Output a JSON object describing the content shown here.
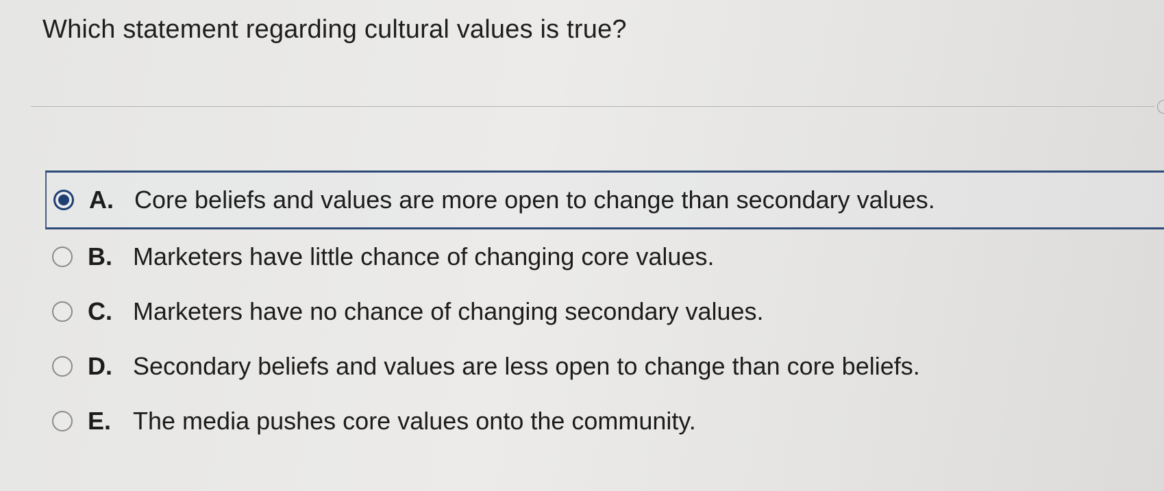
{
  "question": {
    "text": "Which statement regarding cultural values is true?"
  },
  "options": [
    {
      "letter": "A.",
      "text": "Core beliefs and values are more open to change than secondary values.",
      "selected": true
    },
    {
      "letter": "B.",
      "text": "Marketers have little chance of changing core values.",
      "selected": false
    },
    {
      "letter": "C.",
      "text": "Marketers have no chance of changing secondary values.",
      "selected": false
    },
    {
      "letter": "D.",
      "text": "Secondary beliefs and values are less open to change than core beliefs.",
      "selected": false
    },
    {
      "letter": "E.",
      "text": "The media pushes core values onto the community.",
      "selected": false
    }
  ],
  "colors": {
    "selection_accent": "#1f3f73",
    "radio_border": "#8b8b8b"
  }
}
